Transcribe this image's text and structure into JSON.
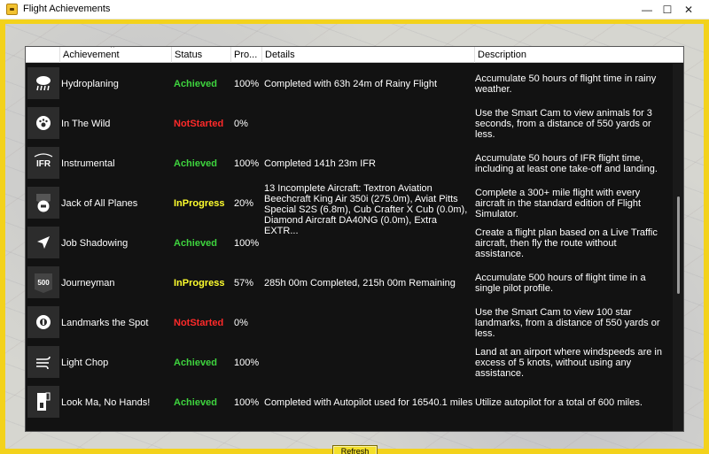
{
  "window": {
    "title": "Flight Achievements",
    "minimize_glyph": "—",
    "maximize_glyph": "☐",
    "close_glyph": "✕"
  },
  "table": {
    "columns": [
      "Achievement",
      "Status",
      "Pro...",
      "Details",
      "Description"
    ],
    "sort_glyph": "^",
    "rows": [
      {
        "icon": "rain-cloud-icon",
        "name": "Hydroplaning",
        "status": "Achieved",
        "progress": "100%",
        "details": "Completed with 63h 24m of Rainy Flight",
        "description": "Accumulate 50 hours of flight time in rainy weather."
      },
      {
        "icon": "paw-camera-icon",
        "name": "In The Wild",
        "status": "NotStarted",
        "progress": "0%",
        "details": "",
        "description": "Use the Smart Cam to view animals for 3 seconds, from a distance of 550 yards or less."
      },
      {
        "icon": "ifr-icon",
        "name": "Instrumental",
        "status": "Achieved",
        "progress": "100%",
        "details": "Completed 141h 23m IFR",
        "description": "Accumulate 50 hours of IFR flight time, including at least one take-off and landing."
      },
      {
        "icon": "badge-medal-icon",
        "name": "Jack of All Planes",
        "status": "InProgress",
        "progress": "20%",
        "details": "13 Incomplete Aircraft: Textron Aviation Beechcraft King Air 350i (275.0m), Aviat Pitts Special S2S (6.8m), Cub Crafter X Cub (0.0m), Diamond Aircraft DA40NG (0.0m), Extra EXTR...",
        "description": "Complete a 300+ mile flight with every aircraft in the standard edition of Flight Simulator."
      },
      {
        "icon": "navigation-arrow-icon",
        "name": "Job Shadowing",
        "status": "Achieved",
        "progress": "100%",
        "details": "",
        "description": "Create a flight plan based on a Live Traffic aircraft, then fly the route without assistance."
      },
      {
        "icon": "badge-500-icon",
        "name": "Journeyman",
        "status": "InProgress",
        "progress": "57%",
        "details": "285h 00m Completed, 215h 00m  Remaining",
        "description": "Accumulate 500 hours of flight time in a single pilot profile."
      },
      {
        "icon": "landmark-camera-icon",
        "name": "Landmarks the Spot",
        "status": "NotStarted",
        "progress": "0%",
        "details": "",
        "description": "Use the Smart Cam to view 100 star landmarks, from a distance of 550 yards or less."
      },
      {
        "icon": "wind-icon",
        "name": "Light Chop",
        "status": "Achieved",
        "progress": "100%",
        "details": "",
        "description": "Land at an airport where windspeeds are in excess of 5 knots, without using any assistance."
      },
      {
        "icon": "autopilot-icon",
        "name": "Look Ma, No Hands!",
        "status": "Achieved",
        "progress": "100%",
        "details": "Completed with Autopilot used for 16540.1 miles",
        "description": "Utilize autopilot for a total of 600 miles."
      }
    ]
  },
  "refresh_label": "Refresh",
  "colors": {
    "achieved": "#3ed43e",
    "not_started": "#ff2a2a",
    "in_progress": "#ffff2e",
    "frame": "#f3d21b"
  }
}
